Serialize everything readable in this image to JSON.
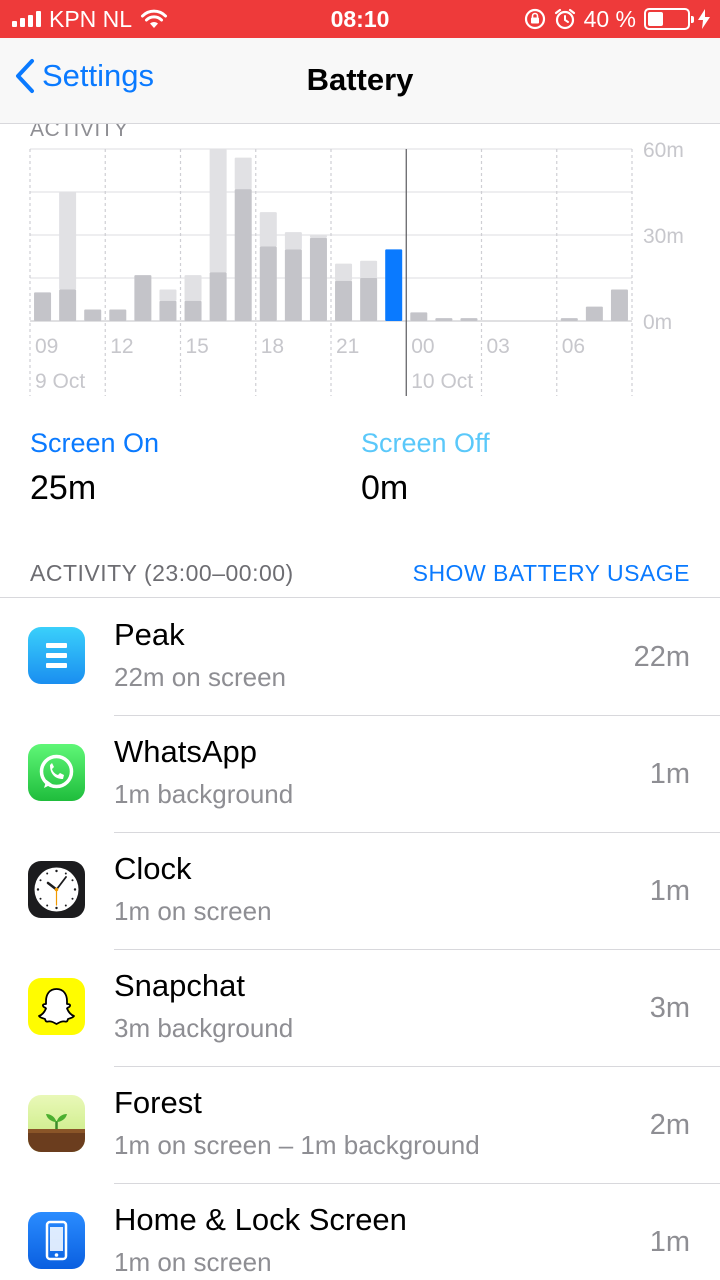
{
  "status_bar": {
    "carrier": "KPN NL",
    "time": "08:10",
    "battery_percent": "40 %",
    "battery_level": 0.4
  },
  "nav": {
    "back_label": "Settings",
    "title": "Battery"
  },
  "chart": {
    "header_label": "ACTIVITY",
    "chart_data": {
      "type": "bar",
      "y_axis_labels": [
        "60m",
        "30m",
        "0m"
      ],
      "ylim": [
        0,
        60
      ],
      "x_tick_labels": [
        "09",
        "12",
        "15",
        "18",
        "21",
        "00",
        "03",
        "06"
      ],
      "day_labels": [
        "9 Oct",
        "10 Oct"
      ],
      "grid": true,
      "series": [
        {
          "values": [
            10,
            11,
            4,
            4,
            16,
            7,
            7,
            17,
            46,
            26,
            25,
            29,
            14,
            15,
            25,
            3,
            1,
            1,
            0,
            0,
            0,
            1,
            5,
            11
          ]
        },
        {
          "values": [
            0,
            34,
            0,
            0,
            0,
            4,
            9,
            43,
            11,
            12,
            6,
            1,
            6,
            6,
            0,
            0,
            0,
            0,
            0,
            0,
            0,
            0,
            0,
            0
          ]
        }
      ],
      "highlighted_index": 14,
      "colors": {
        "screen_on": "#c4c4c9",
        "screen_off": "#e1e1e4",
        "selected": "#0a7aff"
      }
    }
  },
  "metrics": {
    "screen_on_label": "Screen On",
    "screen_on_value": "25m",
    "screen_off_label": "Screen Off",
    "screen_off_value": "0m"
  },
  "section": {
    "title": "ACTIVITY (23:00–00:00)",
    "action": "SHOW BATTERY USAGE"
  },
  "apps": [
    {
      "name": "Peak",
      "detail": "22m on screen",
      "time": "22m",
      "icon": "peak-icon"
    },
    {
      "name": "WhatsApp",
      "detail": "1m background",
      "time": "1m",
      "icon": "whatsapp-icon"
    },
    {
      "name": "Clock",
      "detail": "1m on screen",
      "time": "1m",
      "icon": "clock-icon"
    },
    {
      "name": "Snapchat",
      "detail": "3m background",
      "time": "3m",
      "icon": "snapchat-icon"
    },
    {
      "name": "Forest",
      "detail": "1m on screen – 1m background",
      "time": "2m",
      "icon": "forest-icon"
    },
    {
      "name": "Home & Lock Screen",
      "detail": "1m on screen",
      "time": "1m",
      "icon": "home-lock-screen-icon"
    }
  ]
}
